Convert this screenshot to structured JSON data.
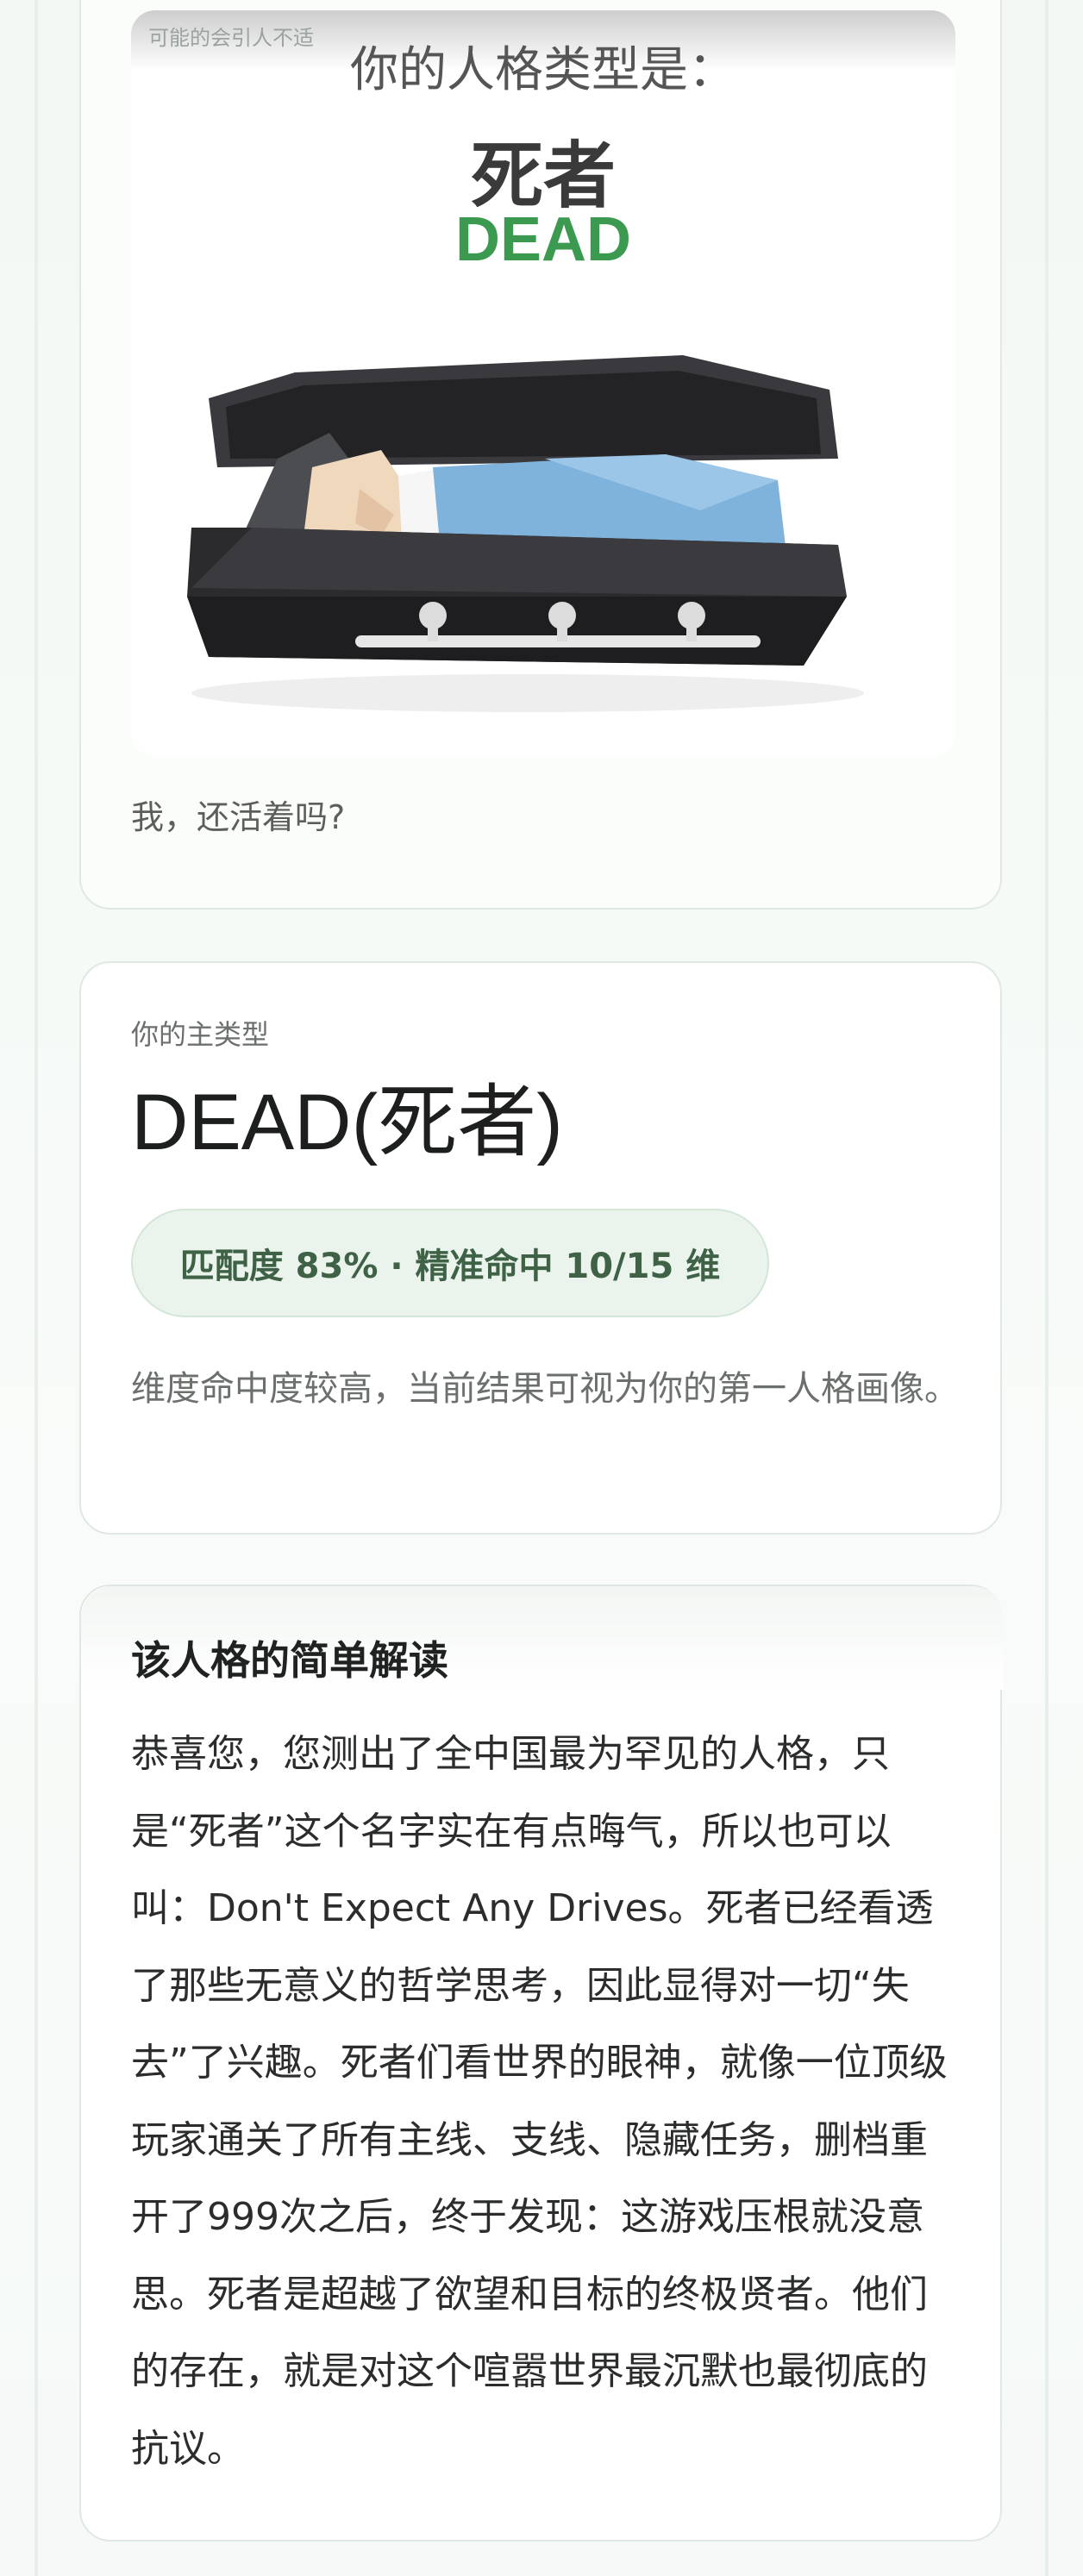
{
  "hero": {
    "watermark": "可能的会引人不适",
    "heading": "你的人格类型是：",
    "name_cn": "死者",
    "name_en": "DEAD",
    "caption": "我，还活着吗?"
  },
  "type_card": {
    "label": "你的主类型",
    "title": "DEAD(死者)",
    "match": "匹配度 83% · 精准命中 10/15 维",
    "description": "维度命中度较高，当前结果可视为你的第一人格画像。"
  },
  "reading": {
    "title": "该人格的简单解读",
    "body": "恭喜您，您测出了全中国最为罕见的人格，只是“死者”这个名字实在有点晦气，所以也可以叫：Don't Expect Any Drives。死者已经看透了那些无意义的哲学思考，因此显得对一切“失去”了兴趣。死者们看世界的眼神，就像一位顶级玩家通关了所有主线、支线、隐藏任务，删档重开了999次之后，终于发现：这游戏压根就没意思。死者是超越了欲望和目标的终极贤者。他们的存在，就是对这个喧嚣世界最沉默也最彻底的抗议。"
  },
  "colors": {
    "accent_green": "#3c9a50",
    "pill_bg": "#eaf4ec",
    "pill_text": "#3f6247",
    "coffin": "#2b2b2e",
    "blanket": "#7fb3dc"
  }
}
